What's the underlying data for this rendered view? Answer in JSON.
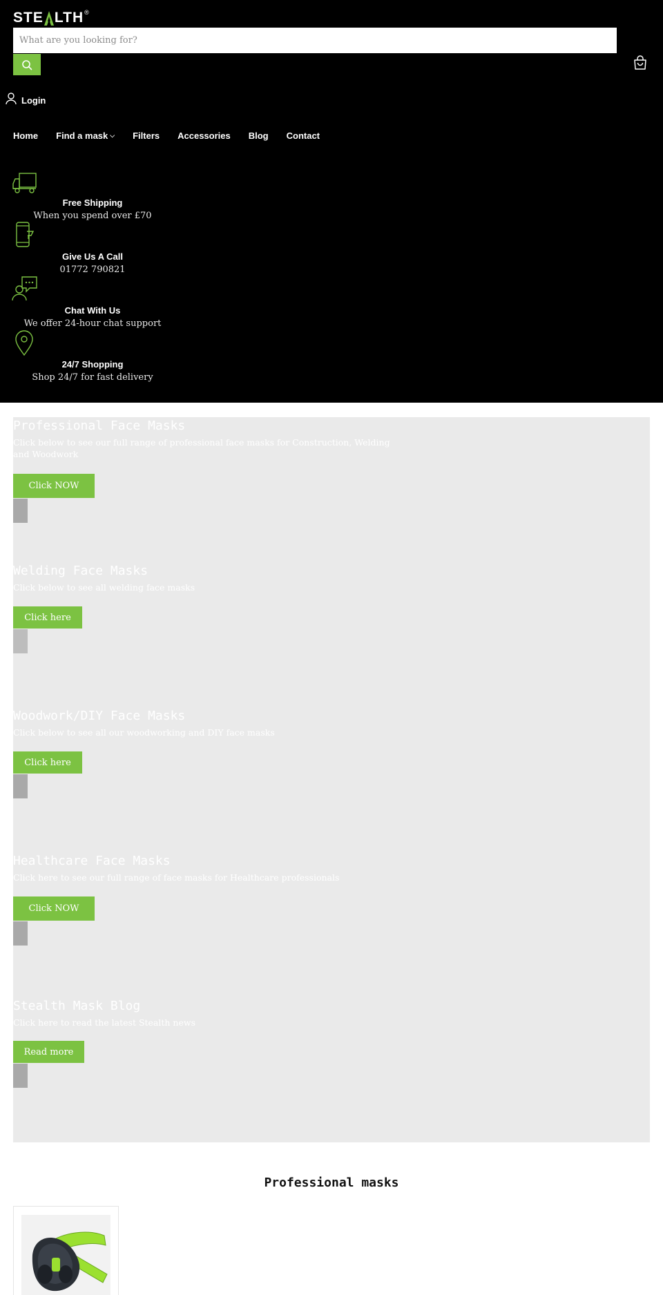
{
  "brand": {
    "logo_text_a": "STE",
    "logo_text_b": "LTH",
    "reg": "®"
  },
  "search": {
    "placeholder": "What are you looking for?"
  },
  "account": {
    "login_label": "Login"
  },
  "nav": {
    "home": "Home",
    "find_mask": "Find a mask",
    "filters": "Filters",
    "accessories": "Accessories",
    "blog": "Blog",
    "contact": "Contact"
  },
  "features": [
    {
      "icon": "truck-icon",
      "title": "Free Shipping",
      "text": "When you spend over £70"
    },
    {
      "icon": "phone-icon",
      "title": "Give Us A Call",
      "text": "01772 790821"
    },
    {
      "icon": "chat-support-icon",
      "title": "Chat With Us",
      "text": "We offer 24-hour chat support"
    },
    {
      "icon": "map-pin-icon",
      "title": "24/7 Shopping",
      "text": "Shop 24/7 for fast delivery"
    }
  ],
  "slides": [
    {
      "title": "Professional Face Masks",
      "text": "Click below to see our full range of professional face masks for Construction, Welding and Woodwork",
      "button": "Click NOW"
    },
    {
      "title": "Welding Face Masks",
      "text": "Click below to see all welding face masks",
      "button": "Click here"
    },
    {
      "title": "Woodwork/DIY Face Masks",
      "text": "Click below to see all our woodworking and DIY face masks",
      "button": "Click here"
    },
    {
      "title": "Healthcare Face Masks",
      "text": "Click here to see our full range of face masks for Healthcare professionals",
      "button": "Click NOW"
    },
    {
      "title": "Stealth Mask Blog",
      "text": "Click here to read the latest Stealth news",
      "button": "Read more"
    }
  ],
  "products_section": {
    "title": "Professional masks"
  },
  "colors": {
    "accent": "#7cc242",
    "header_bg": "#000000",
    "panel_bg": "#eaeaea",
    "indicator": "#a9a9a9"
  }
}
